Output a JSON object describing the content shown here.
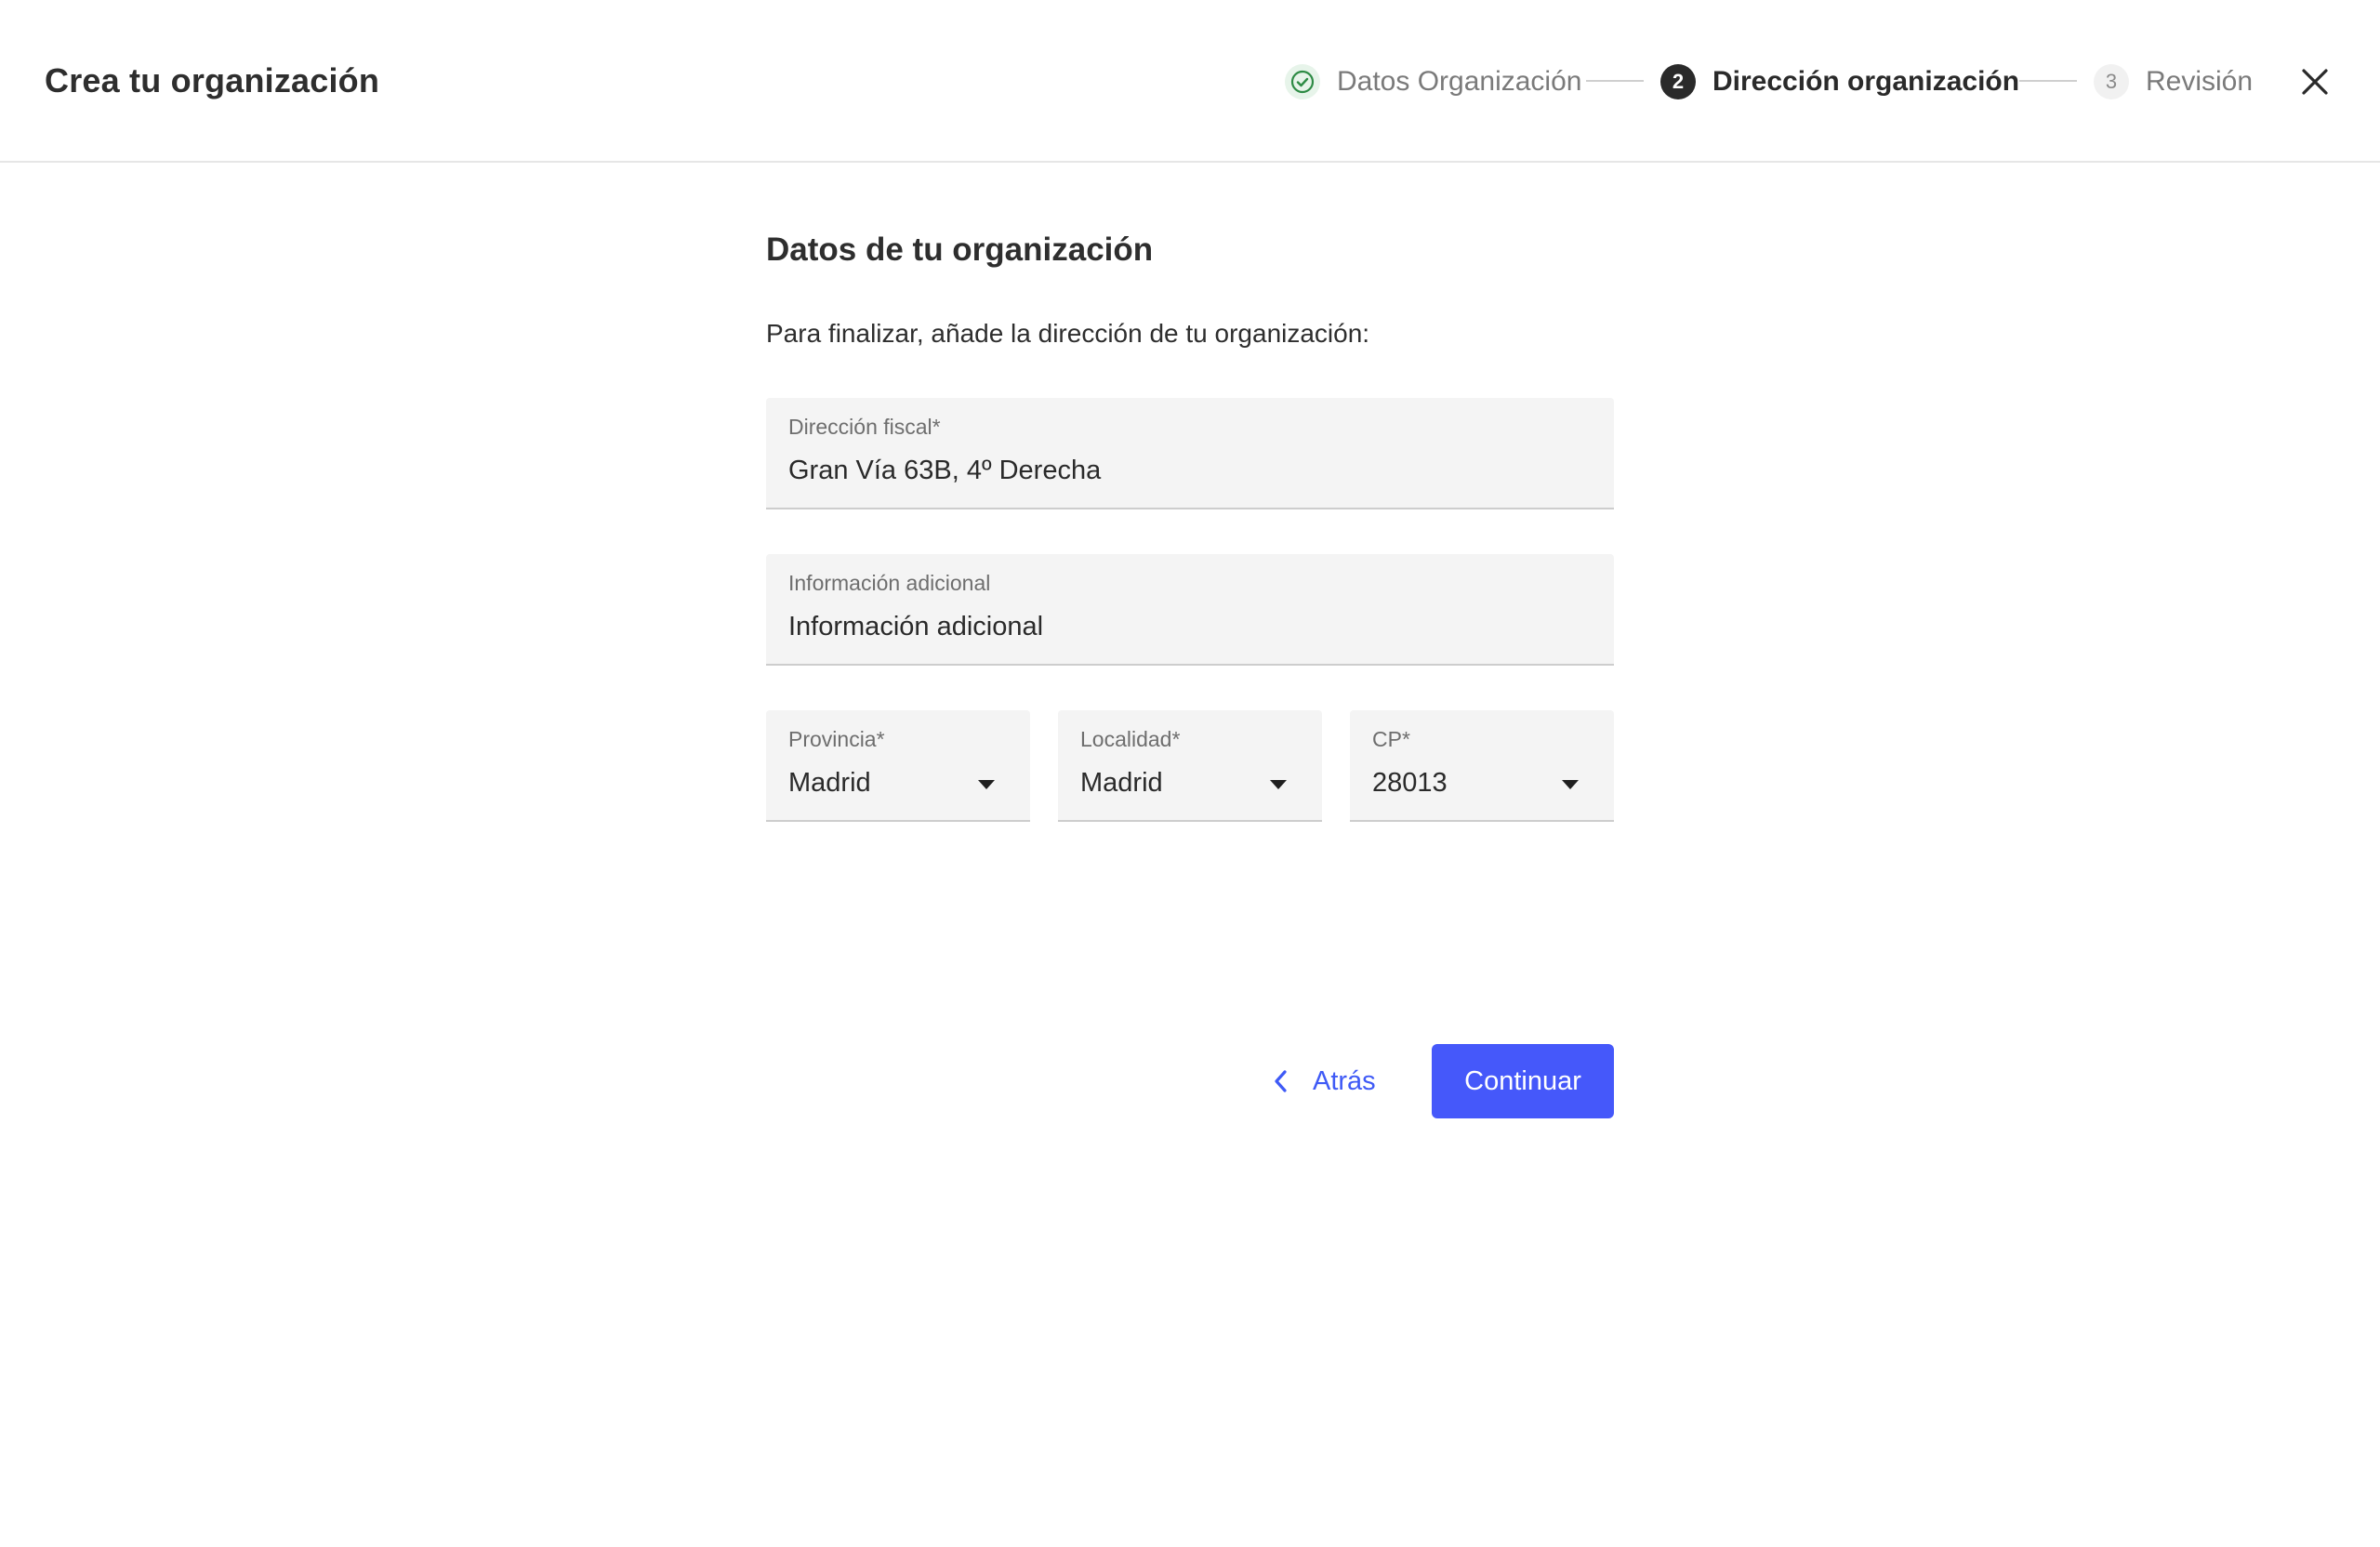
{
  "header": {
    "title": "Crea tu organización",
    "close_icon": "close-icon"
  },
  "stepper": {
    "steps": [
      {
        "number": "",
        "label": "Datos Organización",
        "state": "completed",
        "icon": "check-circle-icon"
      },
      {
        "number": "2",
        "label": "Dirección organización",
        "state": "active"
      },
      {
        "number": "3",
        "label": "Revisión",
        "state": "pending"
      }
    ]
  },
  "form": {
    "title": "Datos de tu organización",
    "description": "Para finalizar, añade la dirección de tu organización:",
    "fiscal_address": {
      "label": "Dirección fiscal*",
      "value": "Gran Vía 63B, 4º Derecha"
    },
    "additional_info": {
      "label": "Información adicional",
      "value": "",
      "placeholder": "Información adicional"
    },
    "province": {
      "label": "Provincia*",
      "value": "Madrid"
    },
    "locality": {
      "label": "Localidad*",
      "value": "Madrid"
    },
    "postal_code": {
      "label": "CP*",
      "value": "28013"
    }
  },
  "actions": {
    "back_label": "Atrás",
    "continue_label": "Continuar"
  },
  "colors": {
    "accent": "#4558fa",
    "success": "#2e8b45",
    "active_step": "#2a2a2a",
    "field_bg": "#f4f4f4"
  }
}
